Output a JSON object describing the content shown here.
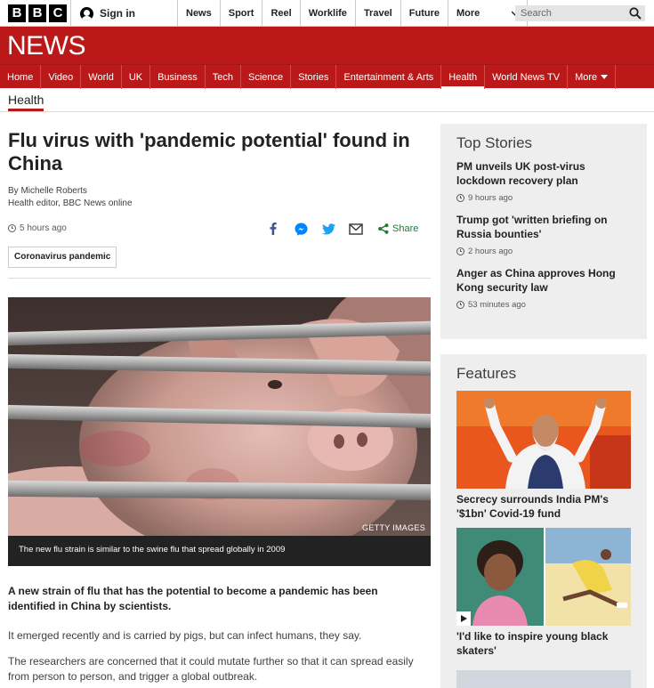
{
  "topbar": {
    "brand": [
      "B",
      "B",
      "C"
    ],
    "signin_label": "Sign in",
    "nav": [
      "News",
      "Sport",
      "Reel",
      "Worklife",
      "Travel",
      "Future"
    ],
    "more_label": "More",
    "search_placeholder": "Search"
  },
  "news_header": {
    "wordmark": "NEWS"
  },
  "section_nav": {
    "items": [
      "Home",
      "Video",
      "World",
      "UK",
      "Business",
      "Tech",
      "Science",
      "Stories",
      "Entertainment & Arts",
      "Health",
      "World News TV",
      "More"
    ],
    "active": "Health"
  },
  "breadcrumb": "Health",
  "article": {
    "headline": "Flu virus with 'pandemic potential' found in China",
    "author": "By Michelle Roberts",
    "author_role": "Health editor, BBC News online",
    "timestamp": "5 hours ago",
    "share_label": "Share",
    "tag": "Coronavirus pandemic",
    "image_credit": "GETTY IMAGES",
    "caption": "The new flu strain is similar to the swine flu that spread globally in 2009",
    "lede": "A new strain of flu that has the potential to become a pandemic has been identified in China by scientists.",
    "para1": "It emerged recently and is carried by pigs, but can infect humans, they say.",
    "para2": "The researchers are concerned that it could mutate further so that it can spread easily from person to person, and trigger a global outbreak."
  },
  "top_stories": {
    "title": "Top Stories",
    "items": [
      {
        "headline": "PM unveils UK post-virus lockdown recovery plan",
        "time": "9 hours ago"
      },
      {
        "headline": "Trump got 'written briefing on Russia bounties'",
        "time": "2 hours ago"
      },
      {
        "headline": "Anger as China approves Hong Kong security law",
        "time": "53 minutes ago"
      }
    ]
  },
  "features": {
    "title": "Features",
    "items": [
      {
        "headline": "Secrecy surrounds India PM's '$1bn' Covid-19 fund"
      },
      {
        "headline": "'I'd like to inspire young black skaters'"
      }
    ]
  },
  "colors": {
    "brand_red": "#bb1919",
    "share_green": "#1a7e31",
    "facebook": "#3b5998",
    "twitter": "#1da1f2",
    "messenger": "#0084ff"
  },
  "icons": [
    "user-icon",
    "chevron-down-icon",
    "search-icon",
    "clock-icon",
    "facebook-icon",
    "messenger-icon",
    "twitter-icon",
    "email-icon",
    "share-icon",
    "play-icon"
  ]
}
